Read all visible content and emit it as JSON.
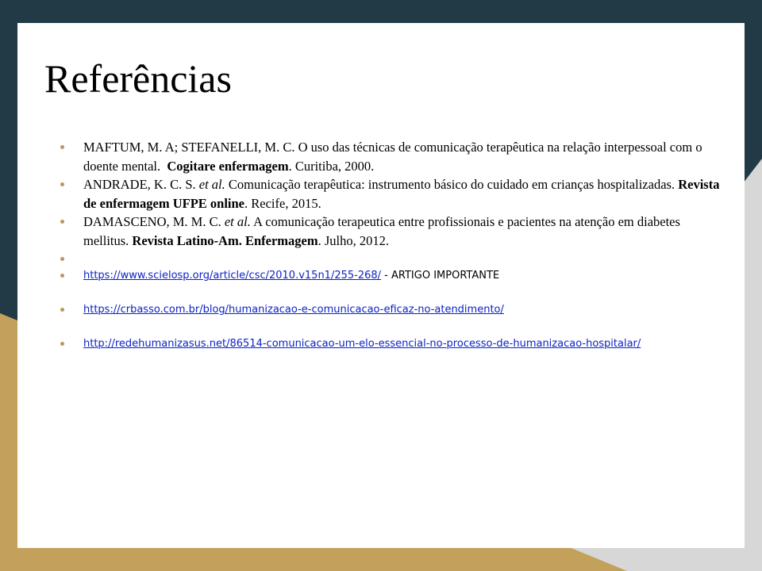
{
  "theme": {
    "dark": "#223a46",
    "gold": "#c3a15a",
    "gray": "#d7d7d7",
    "bullet": "#b59a5c",
    "link": "#0b22c8"
  },
  "slide": {
    "title": "Referências"
  },
  "references": [
    {
      "a": "MAFTUM, M. A; STEFANELLI, M. C. O uso das técnicas de comunicação terapêutica na relação interpessoal com o doente mental.",
      "b": "Cogitare enfermagem",
      "c": ". Curitiba, 2000."
    },
    {
      "a": "ANDRADE, K. C. S.",
      "i": "et al.",
      "b1": "Comunicação terapêutica: instrumento básico do cuidado em crianças hospitalizadas.",
      "bold": "Revista de enfermagem UFPE online",
      "c": ". Recife, 2015."
    },
    {
      "a": "DAMASCENO, M. M. C.",
      "i": "et al.",
      "b1": "A comunicação terapeutica entre profissionais e pacientes na atenção em diabetes mellitus.",
      "bold": "Revista Latino-Am. Enfermagem",
      "c": ". Julho, 2012."
    }
  ],
  "links": [
    {
      "url": "https://www.scielosp.org/article/csc/2010.v15n1/255-268/",
      "note": " - ARTIGO IMPORTANTE"
    },
    {
      "url": "https://crbasso.com.br/blog/humanizacao-e-comunicacao-eficaz-no-atendimento/"
    },
    {
      "url": "http://redehumanizasus.net/86514-comunicacao-um-elo-essencial-no-processo-de-humanizacao-hospitalar/"
    }
  ]
}
